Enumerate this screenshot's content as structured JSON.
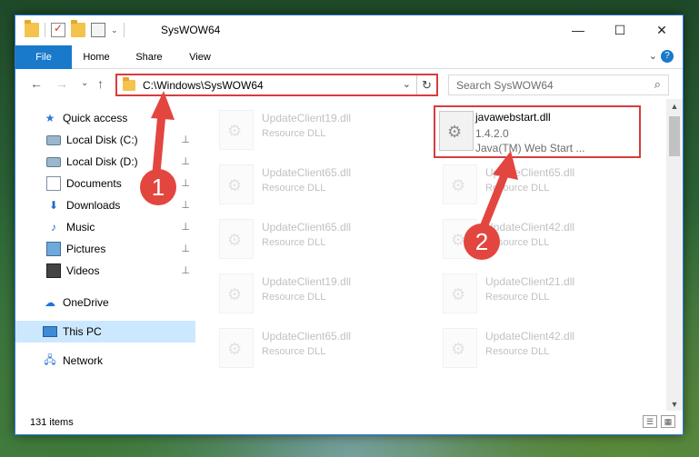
{
  "window": {
    "title": "SysWOW64",
    "controls": {
      "minimize": "—",
      "maximize": "☐",
      "close": "✕"
    }
  },
  "ribbon": {
    "tabs": [
      "File",
      "Home",
      "Share",
      "View"
    ],
    "expand_icon": "⌄",
    "help_icon": "?"
  },
  "address": {
    "path": "C:\\Windows\\SysWOW64",
    "dropdown_icon": "⌄",
    "refresh_icon": "↻"
  },
  "search": {
    "placeholder": "Search SysWOW64",
    "icon": "⌕"
  },
  "nav_glyphs": {
    "back": "←",
    "forward": "→",
    "recent": "⌄",
    "up": "↑"
  },
  "sidebar": {
    "items": [
      {
        "label": "Quick access",
        "icon": "star-icon",
        "pinned": false
      },
      {
        "label": "Local Disk (C:)",
        "icon": "disk-icon",
        "pinned": true
      },
      {
        "label": "Local Disk (D:)",
        "icon": "disk-icon",
        "pinned": true
      },
      {
        "label": "Documents",
        "icon": "document-icon",
        "pinned": true
      },
      {
        "label": "Downloads",
        "icon": "download-icon",
        "pinned": true
      },
      {
        "label": "Music",
        "icon": "music-icon",
        "pinned": true
      },
      {
        "label": "Pictures",
        "icon": "pictures-icon",
        "pinned": true
      },
      {
        "label": "Videos",
        "icon": "video-icon",
        "pinned": true
      },
      {
        "label": "OneDrive",
        "icon": "cloud-icon",
        "pinned": false
      },
      {
        "label": "This PC",
        "icon": "computer-icon",
        "pinned": false,
        "selected": true
      },
      {
        "label": "Network",
        "icon": "network-icon",
        "pinned": false
      }
    ],
    "pin_glyph": "📌"
  },
  "files": {
    "left_column": [
      {
        "name": "UpdateClient19.dll",
        "type": "Resource DLL"
      },
      {
        "name": "UpdateClient65.dll",
        "type": "Resource DLL"
      },
      {
        "name": "UpdateClient65.dll",
        "type": "Resource DLL"
      },
      {
        "name": "UpdateClient19.dll",
        "type": "Resource DLL"
      },
      {
        "name": "UpdateClient65.dll",
        "type": "Resource DLL"
      }
    ],
    "highlighted": {
      "name": "javawebstart.dll",
      "version": "1.4.2.0",
      "description": "Java(TM) Web Start ..."
    },
    "right_column": [
      {
        "name": "UpdateClient65.dll",
        "type": "Resource DLL"
      },
      {
        "name": "UpdateClient42.dll",
        "type": "Resource DLL"
      },
      {
        "name": "UpdateClient21.dll",
        "type": "Resource DLL"
      },
      {
        "name": "UpdateClient42.dll",
        "type": "Resource DLL"
      }
    ]
  },
  "status": {
    "item_count": "131 items"
  },
  "annotations": {
    "step1": "1",
    "step2": "2"
  },
  "colors": {
    "accent": "#1979ca",
    "highlight_border": "#d63d3d",
    "selection": "#cce8ff",
    "annotation": "#e2463f"
  }
}
